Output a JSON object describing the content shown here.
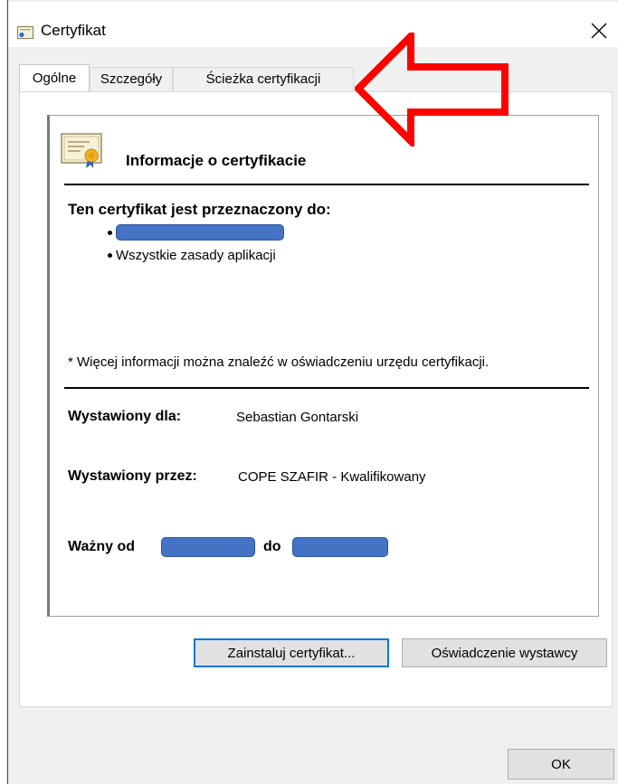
{
  "window": {
    "title": "Certyfikat"
  },
  "tabs": [
    {
      "label": "Ogólne",
      "active": true
    },
    {
      "label": "Szczegóły",
      "active": false
    },
    {
      "label": "Ścieżka certyfikacji",
      "active": false
    }
  ],
  "info": {
    "title": "Informacje o certyfikacie",
    "purpose_title": "Ten certyfikat jest przeznaczony do:",
    "purposes": [
      "",
      "Wszystkie zasady aplikacji"
    ],
    "footnote": "* Więcej informacji można znaleźć w oświadczeniu urzędu certyfikacji.",
    "issued_to_label": "Wystawiony dla:",
    "issued_to_value": "Sebastian Gontarski",
    "issued_by_label": "Wystawiony przez:",
    "issued_by_value": "COPE SZAFIR - Kwalifikowany",
    "valid_from_label": "Ważny od",
    "valid_to_label": "do"
  },
  "buttons": {
    "install": "Zainstaluj certyfikat...",
    "issuer_statement": "Oświadczenie wystawcy",
    "ok": "OK"
  },
  "colors": {
    "redaction": "#4472c4",
    "annotation_arrow": "#ff0000",
    "focus_border": "#0078d7"
  },
  "icons": {
    "title": "certificate-icon",
    "close": "close-icon",
    "cert": "certificate-ribbon-icon"
  }
}
